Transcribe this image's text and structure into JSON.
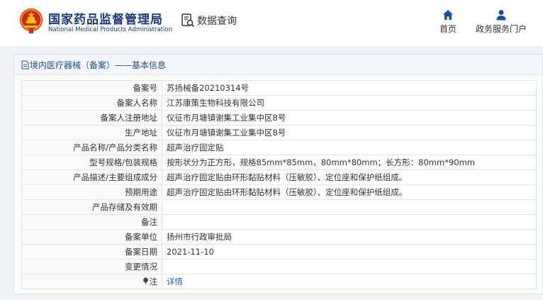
{
  "header": {
    "brand_cn": "国家药品监督管理局",
    "brand_en": "National Medical Products Administration",
    "data_query": "数据查询",
    "nav_home": "首页",
    "nav_gov": "政务服务门户"
  },
  "breadcrumb": {
    "title": "境内医疗器械（备案）——基本信息"
  },
  "rows": [
    {
      "label": "备案号",
      "value": "苏扬械备20210314号"
    },
    {
      "label": "备案人名称",
      "value": "江苏康策生物科技有限公司"
    },
    {
      "label": "备案人注册地址",
      "value": "仪征市月塘镇谢集工业集中区8号"
    },
    {
      "label": "生产地址",
      "value": "仪征市月塘镇谢集工业集中区8号"
    },
    {
      "label": "产品名称/产品分类名称",
      "value": "超声治疗固定贴"
    },
    {
      "label": "型号规格/包装规格",
      "value": "按形状分为正方形，规格85mm*85mm，80mm*80mm；长方形：80mm*90mm"
    },
    {
      "label": "产品描述/主要组成成分",
      "value": "超声治疗固定贴由环形黏贴材料（压敏胶）、定位座和保护纸组成。"
    },
    {
      "label": "预期用途",
      "value": "超声治疗固定贴由环形黏贴材料（压敏胶）、定位座和保护纸组成。"
    },
    {
      "label": "产品存储及有效期",
      "value": ""
    },
    {
      "label": "备注",
      "value": ""
    },
    {
      "label": "备案单位",
      "value": "扬州市行政审批局"
    },
    {
      "label": "备案日期",
      "value": "2021-11-10"
    },
    {
      "label": "变更情况",
      "value": ""
    },
    {
      "label": "注",
      "value": "详情"
    }
  ],
  "colors": {
    "brand": "#1a3a7c",
    "emblem_red": "#d7241d",
    "emblem_gold": "#f3c20c",
    "link": "#2060c0"
  },
  "icons": {
    "emblem": "national-emblem-icon",
    "data_query": "document-search-icon",
    "home": "home-icon",
    "gov": "user-icon",
    "breadcrumb": "document-icon",
    "note": "pin-icon"
  }
}
